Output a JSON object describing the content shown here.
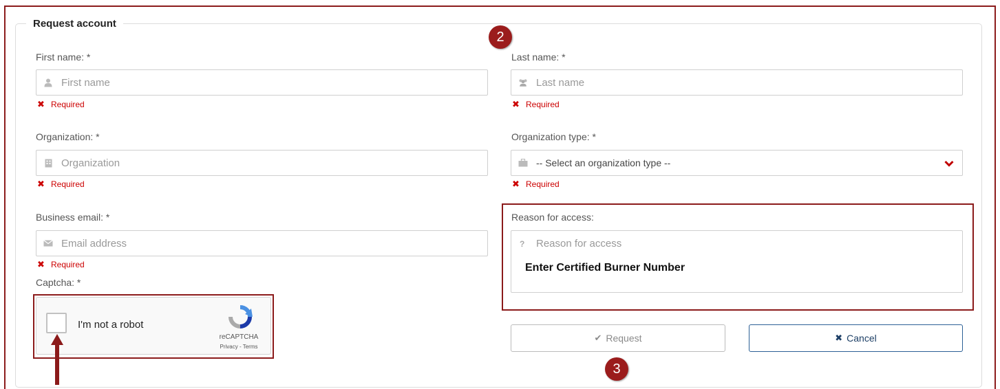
{
  "form": {
    "legend": "Request account",
    "first_name": {
      "label": "First name: *",
      "placeholder": "First name",
      "error": "Required"
    },
    "last_name": {
      "label": "Last name: *",
      "placeholder": "Last name",
      "error": "Required"
    },
    "organization": {
      "label": "Organization: *",
      "placeholder": "Organization",
      "error": "Required"
    },
    "organization_type": {
      "label": "Organization type: *",
      "selected": "-- Select an organization type --",
      "error": "Required"
    },
    "business_email": {
      "label": "Business email: *",
      "placeholder": "Email address",
      "error": "Required"
    },
    "reason": {
      "label": "Reason for access:",
      "placeholder": "Reason for access",
      "entered_text": "Enter Certified Burner Number",
      "icon_glyph": "?"
    },
    "captcha": {
      "label": "Captcha: *",
      "checkbox_text": "I'm not a robot",
      "brand": "reCAPTCHA",
      "links": "Privacy - Terms"
    },
    "buttons": {
      "request": "Request",
      "cancel": "Cancel"
    }
  },
  "annotations": {
    "step_2": "2",
    "step_3": "3"
  },
  "icons": {
    "first_name": "user-icon",
    "last_name": "users-icon",
    "organization": "building-icon",
    "organization_type": "briefcase-icon",
    "email": "envelope-icon",
    "select_chevron": "chevron-down-icon",
    "request": "check-icon",
    "cancel": "x-icon",
    "error": "x-icon"
  },
  "colors": {
    "annotation": "#8b1a1a",
    "error": "#cc0000",
    "cancel_border": "#2b5f95",
    "chevron": "#c00000"
  }
}
